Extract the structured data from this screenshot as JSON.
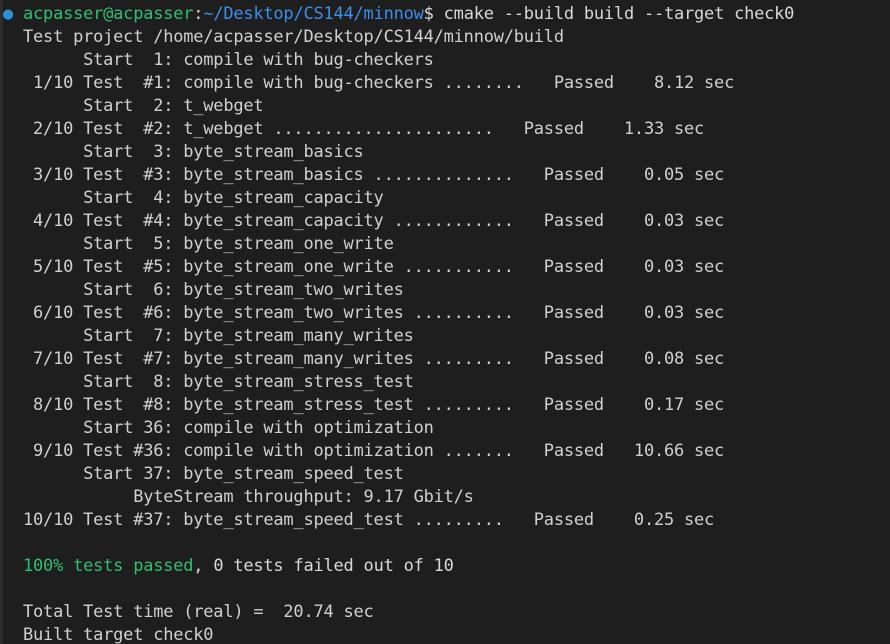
{
  "terminal": {
    "background_color": "#1e1e1e",
    "foreground_color": "#d6d6d6",
    "prompt_user_color": "#2fbf71",
    "prompt_path_color": "#3b8eea",
    "success_color": "#2fbf71",
    "bullet_color": "#2d8fd5"
  },
  "prompt": {
    "bullet": "●",
    "user_host": "acpasser@acpasser",
    "separator": ":",
    "path": "~/Desktop/CS144/minnow",
    "sigil": "$",
    "command": "cmake --build build --target check0"
  },
  "output": {
    "project_line": "Test project /home/acpasser/Desktop/CS144/minnow/build",
    "throughput_line": "ByteStream throughput: 9.17 Gbit/s",
    "summary_green": "100% tests passed",
    "summary_rest": ", 0 tests failed out of 10",
    "total_time_line": "Total Test time (real) =  20.74 sec",
    "built_target_line": "Built target check0",
    "start_label": "Start",
    "test_label": "Test",
    "status_label": "Passed",
    "sec_label": "sec"
  },
  "tests": [
    {
      "index": "1/10",
      "number": "1",
      "name": "compile with bug-checkers",
      "dots": ". . . . . . . .",
      "status": "Passed",
      "time": "8.12"
    },
    {
      "index": "2/10",
      "number": "2",
      "name": "t_webget",
      "dots": ". . . . . . . . . . . . . .",
      "status": "Passed",
      "time": "1.33"
    },
    {
      "index": "3/10",
      "number": "3",
      "name": "byte_stream_basics",
      "dots": ". . . . . . . . . .",
      "status": "Passed",
      "time": "0.05"
    },
    {
      "index": "4/10",
      "number": "4",
      "name": "byte_stream_capacity",
      "dots": ". . . . . . . . .",
      "status": "Passed",
      "time": "0.03"
    },
    {
      "index": "5/10",
      "number": "5",
      "name": "byte_stream_one_write",
      "dots": ". . . . . . . . .",
      "status": "Passed",
      "time": "0.03"
    },
    {
      "index": "6/10",
      "number": "6",
      "name": "byte_stream_two_writes",
      "dots": ". . . . . . . .",
      "status": "Passed",
      "time": "0.03"
    },
    {
      "index": "7/10",
      "number": "7",
      "name": "byte_stream_many_writes",
      "dots": ". . . . . . .",
      "status": "Passed",
      "time": "0.08"
    },
    {
      "index": "8/10",
      "number": "8",
      "name": "byte_stream_stress_test",
      "dots": ". . . . . . .",
      "status": "Passed",
      "time": "0.17"
    },
    {
      "index": "9/10",
      "number": "36",
      "name": "compile with optimization",
      "dots": ". . . . . .",
      "status": "Passed",
      "time": "10.66"
    },
    {
      "index": "10/10",
      "number": "37",
      "name": "byte_stream_speed_test",
      "dots": ". . . . . . .",
      "status": "Passed",
      "time": "0.25"
    }
  ],
  "lines": [
    {
      "kind": "prompt"
    },
    {
      "kind": "plain",
      "text": "  Test project /home/acpasser/Desktop/CS144/minnow/build"
    },
    {
      "kind": "plain",
      "text": "        Start  1: compile with bug-checkers"
    },
    {
      "kind": "plain",
      "text": "   1/10 Test  #1: compile with bug-checkers ........   Passed    8.12 sec"
    },
    {
      "kind": "plain",
      "text": "        Start  2: t_webget"
    },
    {
      "kind": "plain",
      "text": "   2/10 Test  #2: t_webget ......................   Passed    1.33 sec"
    },
    {
      "kind": "plain",
      "text": "        Start  3: byte_stream_basics"
    },
    {
      "kind": "plain",
      "text": "   3/10 Test  #3: byte_stream_basics ..............   Passed    0.05 sec"
    },
    {
      "kind": "plain",
      "text": "        Start  4: byte_stream_capacity"
    },
    {
      "kind": "plain",
      "text": "   4/10 Test  #4: byte_stream_capacity ............   Passed    0.03 sec"
    },
    {
      "kind": "plain",
      "text": "        Start  5: byte_stream_one_write"
    },
    {
      "kind": "plain",
      "text": "   5/10 Test  #5: byte_stream_one_write ...........   Passed    0.03 sec"
    },
    {
      "kind": "plain",
      "text": "        Start  6: byte_stream_two_writes"
    },
    {
      "kind": "plain",
      "text": "   6/10 Test  #6: byte_stream_two_writes ..........   Passed    0.03 sec"
    },
    {
      "kind": "plain",
      "text": "        Start  7: byte_stream_many_writes"
    },
    {
      "kind": "plain",
      "text": "   7/10 Test  #7: byte_stream_many_writes .........   Passed    0.08 sec"
    },
    {
      "kind": "plain",
      "text": "        Start  8: byte_stream_stress_test"
    },
    {
      "kind": "plain",
      "text": "   8/10 Test  #8: byte_stream_stress_test .........   Passed    0.17 sec"
    },
    {
      "kind": "plain",
      "text": "        Start 36: compile with optimization"
    },
    {
      "kind": "plain",
      "text": "   9/10 Test #36: compile with optimization .......   Passed   10.66 sec"
    },
    {
      "kind": "plain",
      "text": "        Start 37: byte_stream_speed_test"
    },
    {
      "kind": "plain",
      "text": "             ByteStream throughput: 9.17 Gbit/s"
    },
    {
      "kind": "plain",
      "text": "  10/10 Test #37: byte_stream_speed_test .........   Passed    0.25 sec"
    },
    {
      "kind": "blank",
      "text": ""
    },
    {
      "kind": "summary"
    },
    {
      "kind": "blank",
      "text": ""
    },
    {
      "kind": "plain",
      "text": "  Total Test time (real) =  20.74 sec"
    },
    {
      "kind": "plain",
      "text": "  Built target check0"
    }
  ]
}
